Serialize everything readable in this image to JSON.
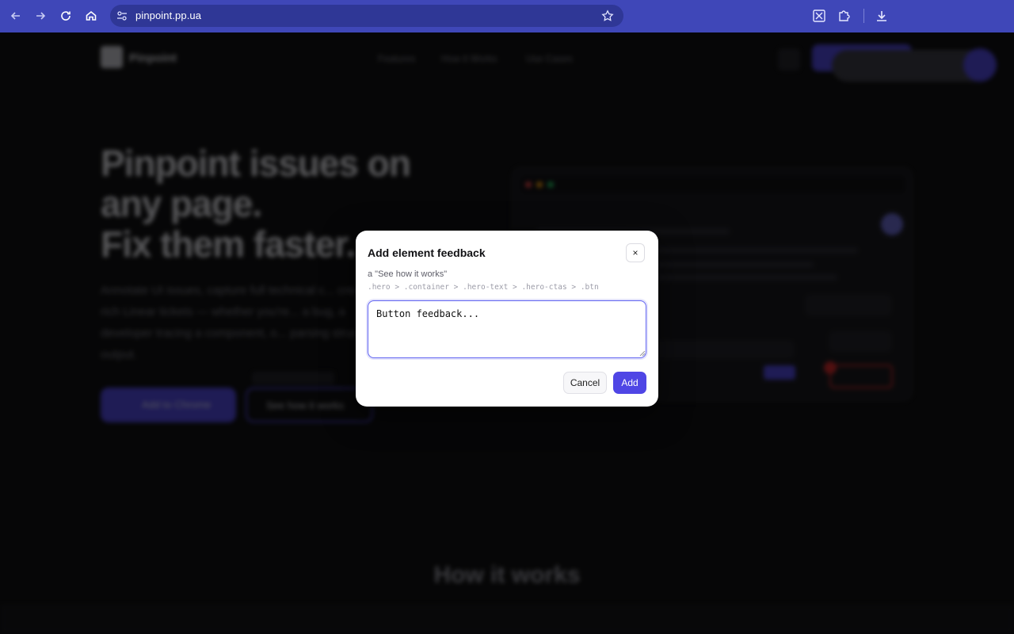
{
  "browser": {
    "url": "pinpoint.pp.ua",
    "icons": {
      "back": "arrow-left-icon",
      "forward": "arrow-right-icon",
      "reload": "reload-icon",
      "home": "home-icon",
      "site_info": "tune-icon",
      "bookmark": "star-icon",
      "extension_pinpoint": "pinpoint-extension-icon",
      "extensions": "puzzle-icon",
      "download": "download-icon"
    },
    "accent_color": "#3f47b8"
  },
  "background_page": {
    "brand": "Pinpoint",
    "nav": [
      "Features",
      "How it Works",
      "Use Cases"
    ],
    "hero": {
      "title_lines": [
        "Pinpoint issues on",
        "any page.",
        "Fix them faster."
      ],
      "subtitle": "Annotate UI issues, capture full technical c... create rich Linear tickets — whether you're... a bug, a developer tracing a component, o... parsing structured output.",
      "primary_cta": "Add to Chrome",
      "secondary_cta": "See how it works",
      "tooltip": "\"See how it works\""
    },
    "mock_url": "app.example.com/dashboard",
    "section_title": "How it works"
  },
  "modal": {
    "title": "Add element feedback",
    "close_label": "×",
    "target_label": "a \"See how it works\"",
    "selector_path": ".hero > .container > .hero-text > .hero-ctas > .btn",
    "input_value": "Button feedback...",
    "cancel_label": "Cancel",
    "add_label": "Add",
    "primary_color": "#4f46e5"
  }
}
